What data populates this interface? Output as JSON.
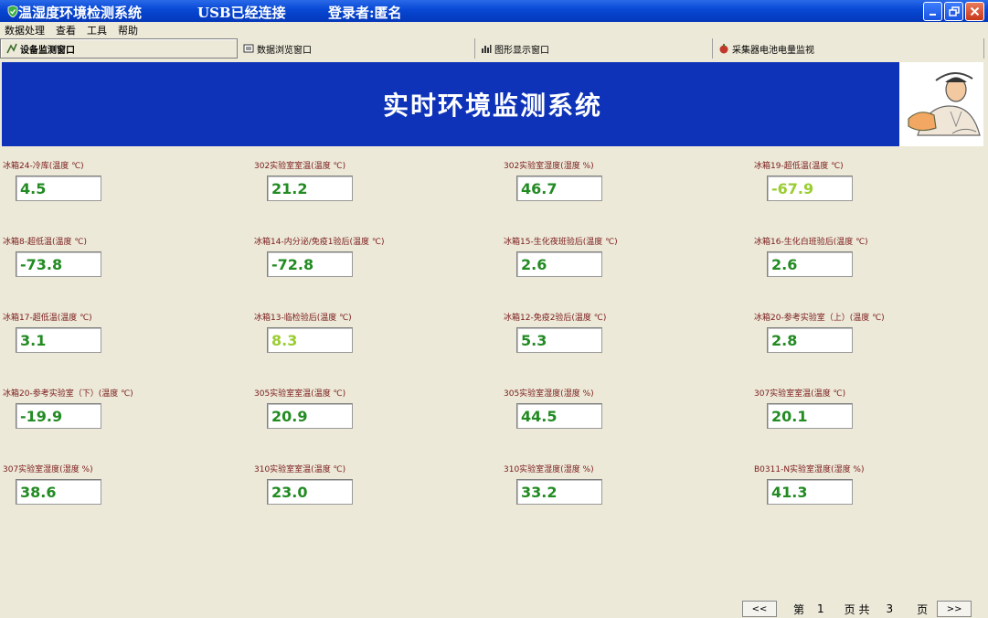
{
  "titlebar": {
    "app_title": "温湿度环境检测系统",
    "usb_status": "USB已经连接",
    "user_label": "登录者:匿名"
  },
  "menu": [
    "数据处理",
    "查看",
    "工具",
    "帮助"
  ],
  "tabs": [
    {
      "label": "设备监测窗口",
      "icon": "monitor-icon"
    },
    {
      "label": "数据浏览窗口",
      "icon": "browse-icon"
    },
    {
      "label": "图形显示窗口",
      "icon": "chart-icon"
    },
    {
      "label": "采集器电池电量监视",
      "icon": "battery-icon"
    }
  ],
  "banner": {
    "title": "实时环境监测系统"
  },
  "colors": {
    "normal": "#228b22",
    "alert": "#9acd32",
    "label": "#7a1a1a",
    "banner": "#0e33b8"
  },
  "sensors": [
    {
      "label": "冰箱24-冷库(温度 ℃)",
      "value": "4.5",
      "status": "normal"
    },
    {
      "label": "302实验室室温(温度 ℃)",
      "value": "21.2",
      "status": "normal"
    },
    {
      "label": "302实验室湿度(湿度 %)",
      "value": "46.7",
      "status": "normal"
    },
    {
      "label": "冰箱19-超低温(温度 ℃)",
      "value": "-67.9",
      "status": "alert"
    },
    {
      "label": "冰箱8-超低温(温度 ℃)",
      "value": "-73.8",
      "status": "normal"
    },
    {
      "label": "冰箱14-内分泌/免疫1验后(温度 ℃)",
      "value": "-72.8",
      "status": "normal"
    },
    {
      "label": "冰箱15-生化夜班验后(温度 ℃)",
      "value": "2.6",
      "status": "normal"
    },
    {
      "label": "冰箱16-生化白班验后(温度 ℃)",
      "value": "2.6",
      "status": "normal"
    },
    {
      "label": "冰箱17-超低温(温度 ℃)",
      "value": "3.1",
      "status": "normal"
    },
    {
      "label": "冰箱13-临检验后(温度 ℃)",
      "value": "8.3",
      "status": "alert"
    },
    {
      "label": "冰箱12-免疫2验后(温度 ℃)",
      "value": "5.3",
      "status": "normal"
    },
    {
      "label": "冰箱20-参考实验室（上）(温度 ℃)",
      "value": "2.8",
      "status": "normal"
    },
    {
      "label": "冰箱20-参考实验室（下）(温度 ℃)",
      "value": "-19.9",
      "status": "normal"
    },
    {
      "label": "305实验室室温(温度 ℃)",
      "value": "20.9",
      "status": "normal"
    },
    {
      "label": "305实验室湿度(湿度 %)",
      "value": "44.5",
      "status": "normal"
    },
    {
      "label": "307实验室室温(温度 ℃)",
      "value": "20.1",
      "status": "normal"
    },
    {
      "label": "307实验室湿度(湿度 %)",
      "value": "38.6",
      "status": "normal"
    },
    {
      "label": "310实验室室温(温度 ℃)",
      "value": "23.0",
      "status": "normal"
    },
    {
      "label": "310实验室湿度(湿度 %)",
      "value": "33.2",
      "status": "normal"
    },
    {
      "label": "B0311-N实验室湿度(湿度 %)",
      "value": "41.3",
      "status": "normal"
    }
  ],
  "pager": {
    "prev": "<<",
    "page_prefix": "第",
    "current": "1",
    "page_mid": "页 共",
    "total": "3",
    "page_suffix": "页",
    "next": ">>"
  }
}
